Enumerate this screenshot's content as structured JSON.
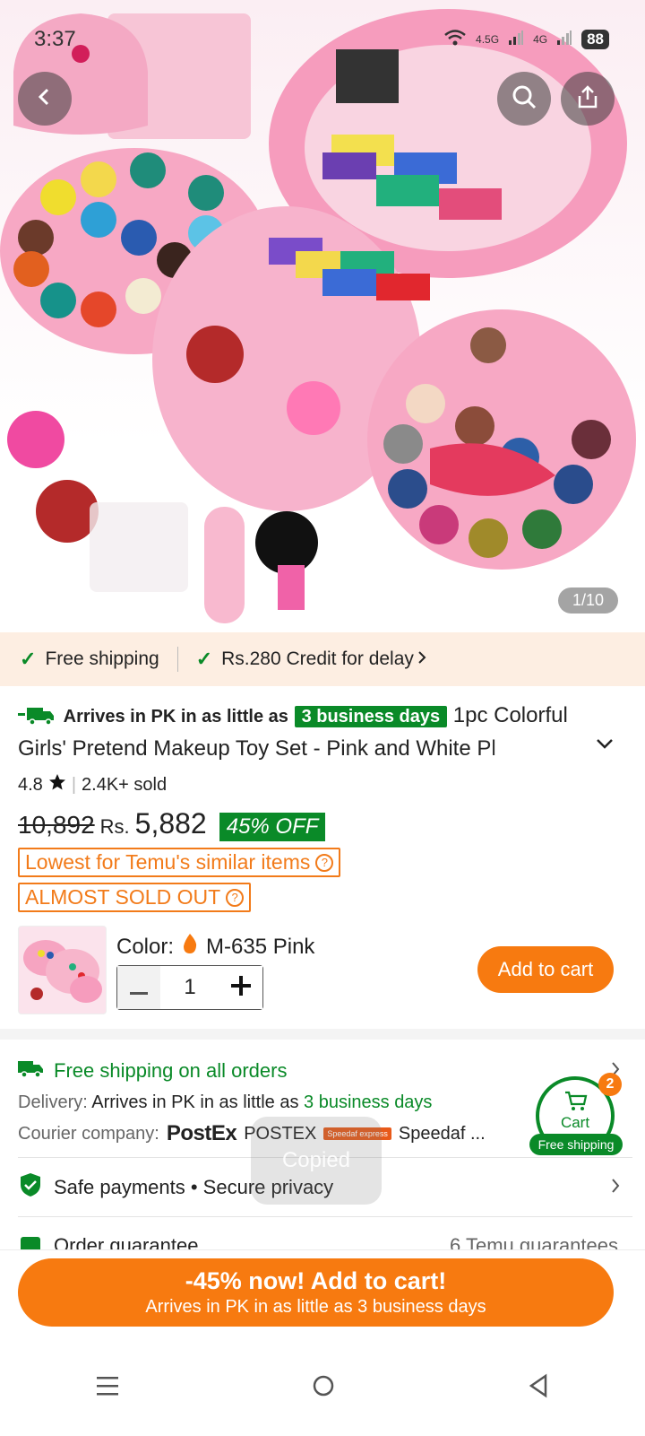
{
  "status": {
    "time": "3:37",
    "net1": "4.5G",
    "net2": "4G",
    "battery": "88"
  },
  "gallery": {
    "counter": "1/10"
  },
  "shipping_bar": {
    "free_shipping": "Free shipping",
    "credit": "Rs.280 Credit for delay"
  },
  "product": {
    "arrives_prefix": "Arrives in PK in as little as",
    "arrives_days": "3 business days",
    "title": "1pc Colorful Girls' Pretend Makeup Toy Set - Pink and White Pl",
    "rating": "4.8",
    "sold": "2.4K+ sold",
    "original_price": "10,892",
    "currency": "Rs.",
    "price": "5,882",
    "discount": "45% OFF",
    "tag_lowest": "Lowest for Temu's similar items",
    "tag_soldout": "ALMOST SOLD OUT",
    "color_label": "Color:",
    "color_value": "M-635 Pink",
    "quantity": "1",
    "add_to_cart": "Add to cart"
  },
  "shipping_info": {
    "free_all": "Free shipping on all orders",
    "delivery_label": "Delivery:",
    "delivery_text": "Arrives in PK in as little as",
    "delivery_days": "3 business days",
    "courier_label": "Courier company:",
    "courier_logo": "PostEx",
    "courier1": "POSTEX",
    "courier2_logo": "Speedaf express",
    "courier2": "Speedaf ..."
  },
  "cart_float": {
    "label": "Cart",
    "badge": "2",
    "ship": "Free shipping"
  },
  "toast": "Copied",
  "safe_payments": "Safe payments • Secure privacy",
  "order_guarantee": {
    "label": "Order guarantee",
    "value": "6 Temu guarantees"
  },
  "cta": {
    "line1": "-45% now! Add to cart!",
    "line2": "Arrives in PK in as little as 3 business days"
  },
  "colors": {
    "orange": "#f77a10",
    "green": "#0a8a28",
    "pink": "#f4a6c3"
  }
}
